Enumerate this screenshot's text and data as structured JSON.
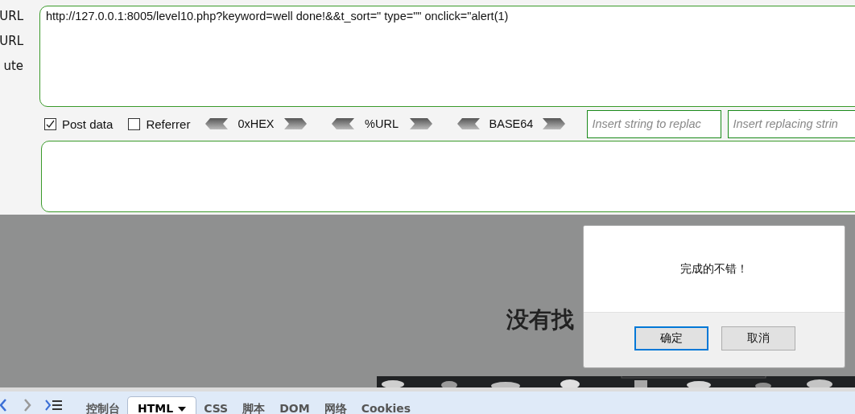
{
  "side_labels": [
    "URL",
    "URL",
    "ute"
  ],
  "url_field": {
    "value": "http://127.0.0.1:8005/level10.php?keyword=well done!&&t_sort=\" type=\"\" onclick=\"alert(1)"
  },
  "options": [
    {
      "label": "Post data",
      "checked": true
    },
    {
      "label": "Referrer",
      "checked": false
    }
  ],
  "encoders": [
    {
      "label": "0xHEX"
    },
    {
      "label": "%URL"
    },
    {
      "label": "BASE64"
    }
  ],
  "replace_fields": [
    {
      "placeholder": "Insert string to replac"
    },
    {
      "placeholder": "Insert replacing strin"
    }
  ],
  "page": {
    "subheading_left": "没有找"
  },
  "dialog": {
    "message": "完成的不错！",
    "buttons": [
      {
        "label": "确定",
        "focused": true
      },
      {
        "label": "取消",
        "focused": false
      }
    ]
  },
  "devtools": {
    "tabs": [
      {
        "label": "控制台",
        "selected": false,
        "dropdown": false
      },
      {
        "label": "HTML",
        "selected": true,
        "dropdown": true
      },
      {
        "label": "CSS",
        "selected": false,
        "dropdown": false
      },
      {
        "label": "脚本",
        "selected": false,
        "dropdown": false
      },
      {
        "label": "DOM",
        "selected": false,
        "dropdown": false
      },
      {
        "label": "网络",
        "selected": false,
        "dropdown": false
      },
      {
        "label": "Cookies",
        "selected": false,
        "dropdown": false
      }
    ]
  }
}
